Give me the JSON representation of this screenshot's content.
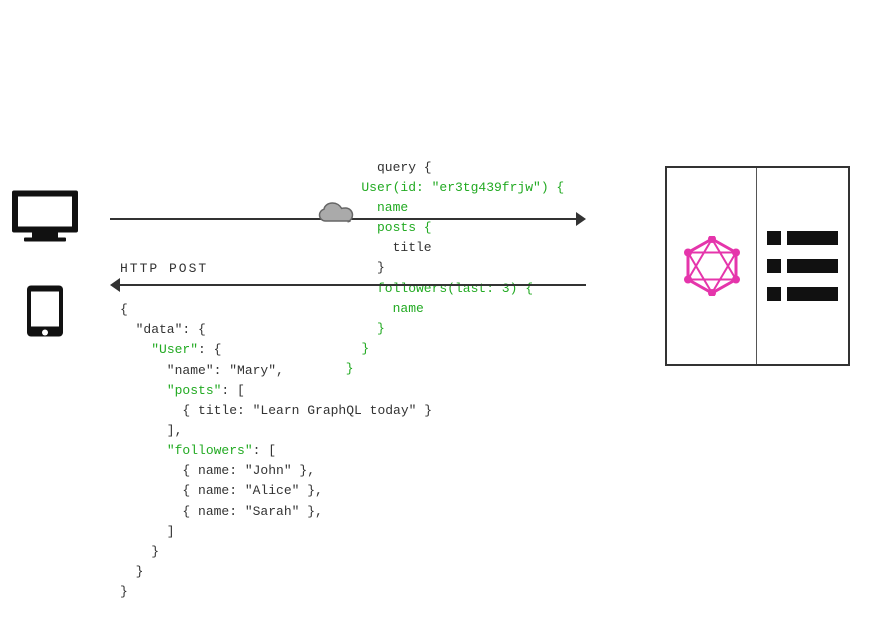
{
  "query": {
    "lines": [
      {
        "text": "query {",
        "color": "default"
      },
      {
        "text": "  User(id: \"er3tg439frjw\") {",
        "color": "green"
      },
      {
        "text": "    name",
        "color": "green"
      },
      {
        "text": "    posts {",
        "color": "green"
      },
      {
        "text": "      title",
        "color": "default"
      },
      {
        "text": "    }",
        "color": "default"
      },
      {
        "text": "    followers(last: 3) {",
        "color": "green"
      },
      {
        "text": "      name",
        "color": "green"
      },
      {
        "text": "    }",
        "color": "default"
      },
      {
        "text": "  }",
        "color": "default"
      },
      {
        "text": "}",
        "color": "default"
      }
    ]
  },
  "http_label": "HTTP POST",
  "response": {
    "lines": [
      {
        "text": "{",
        "color": "default"
      },
      {
        "text": "  \"data\": {",
        "color": "default"
      },
      {
        "text": "    \"User\": {",
        "color": "green"
      },
      {
        "text": "      \"name\": \"Mary\",",
        "color": "default"
      },
      {
        "text": "      \"posts\": [",
        "color": "green"
      },
      {
        "text": "        { title: \"Learn GraphQL today\" }",
        "color": "default"
      },
      {
        "text": "      ],",
        "color": "default"
      },
      {
        "text": "      \"followers\": [",
        "color": "green"
      },
      {
        "text": "        { name: \"John\" },",
        "color": "default"
      },
      {
        "text": "        { name: \"Alice\" },",
        "color": "default"
      },
      {
        "text": "        { name: \"Sarah\" },",
        "color": "default"
      },
      {
        "text": "      ]",
        "color": "default"
      },
      {
        "text": "    }",
        "color": "default"
      },
      {
        "text": "  }",
        "color": "default"
      },
      {
        "text": "}",
        "color": "default"
      }
    ]
  }
}
